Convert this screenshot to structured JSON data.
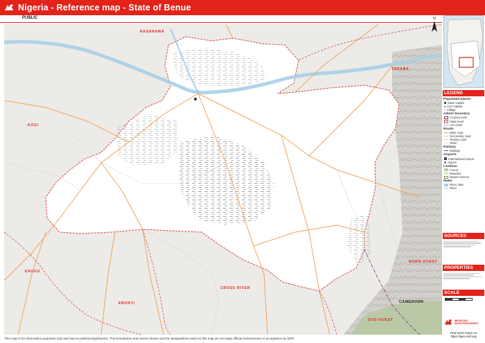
{
  "header": {
    "title": "Nigeria  -  Reference map  -  State of Benue",
    "classification": "PUBLIC"
  },
  "map": {
    "neighbor_states": [
      "NASARAWA",
      "TARABA",
      "KOGI",
      "ENUGU",
      "EBONYI",
      "CROSS RIVER"
    ],
    "neighbor_country": {
      "name": "CAMEROON",
      "region_nord": "NORD-OUEST",
      "region_sud": "SUD-OUEST"
    },
    "north_arrow": "N",
    "colors": {
      "header": "#e2231a",
      "state_fill": "#ffffff",
      "outside": "#ecebe8",
      "river": "#a9cfe6",
      "roads_major": "#f0a35a"
    }
  },
  "legend": {
    "title": "LEGEND",
    "groups": [
      {
        "heading": "Populated places",
        "items": [
          "State capital",
          "LGA capital",
          "Village"
        ]
      },
      {
        "heading": "Admin boundary",
        "items": [
          "Country level",
          "State level",
          "LGA level"
        ]
      },
      {
        "heading": "Roads",
        "items": [
          "Main road",
          "Secondary road",
          "Tertiary road",
          "Other"
        ]
      },
      {
        "heading": "Railway",
        "items": [
          "Railway"
        ]
      },
      {
        "heading": "Airports",
        "items": [
          "International Airport",
          "Airport"
        ]
      },
      {
        "heading": "Landuse",
        "items": [
          "Forest",
          "Meadow",
          "Nature reserve"
        ]
      },
      {
        "heading": "Water",
        "items": [
          "River, lake",
          "River"
        ]
      }
    ]
  },
  "sources": {
    "title": "SOURCES"
  },
  "properties": {
    "title": "PROPERTIES"
  },
  "scale": {
    "title": "SCALE"
  },
  "logo": {
    "line1": "MEDECINS",
    "line2": "SANS FRONTIERES"
  },
  "find_more": {
    "line1": "Find more maps on",
    "line2": "https://geo.msf.org"
  },
  "footer": {
    "disclaimer": "This map is for information purposes only and has no political significance. The boundaries and names shown and the designations used on this map do not imply official endorsement or acceptance by MSF."
  }
}
